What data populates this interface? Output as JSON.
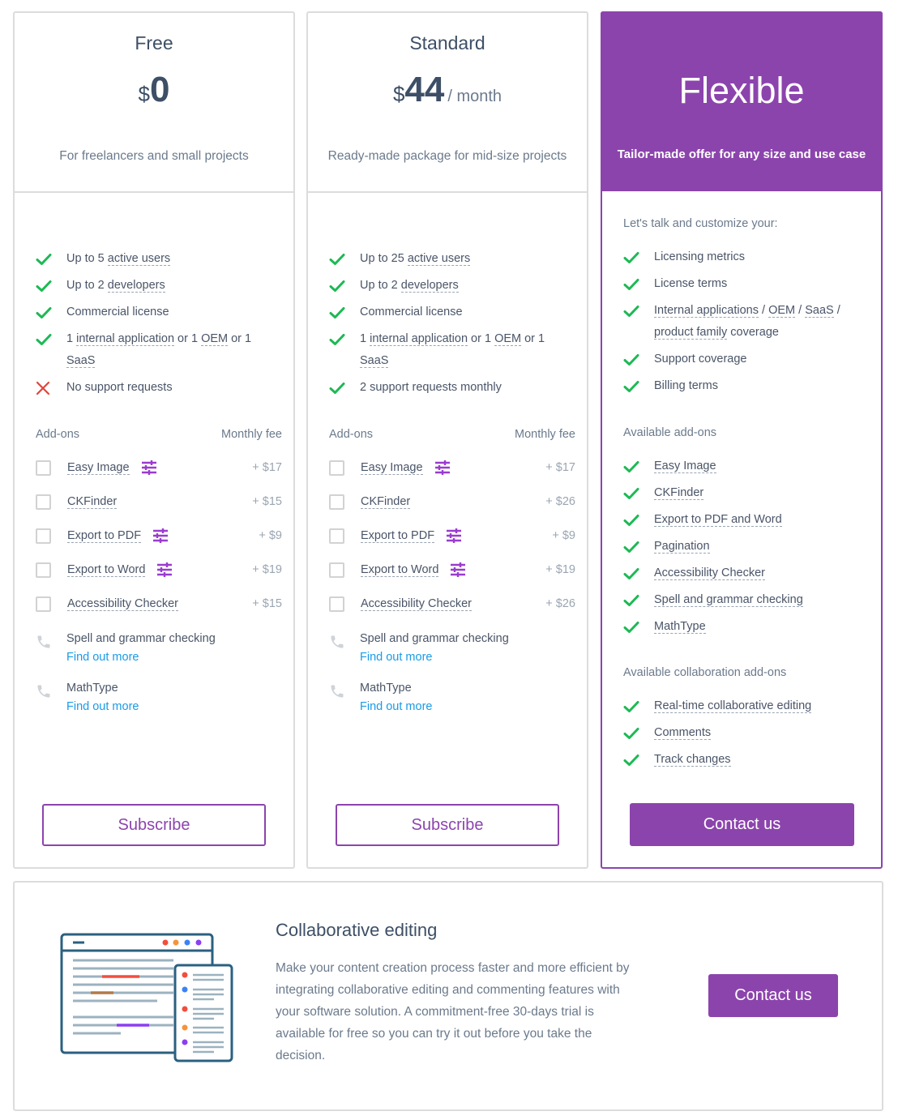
{
  "colors": {
    "accent": "#8c44ad",
    "check": "#1db954",
    "cross": "#e0453a",
    "link": "#1a9be6",
    "text": "#4a5568",
    "muted": "#6b7a8c"
  },
  "plans": {
    "free": {
      "name": "Free",
      "currency": "$",
      "amount": "0",
      "period": "",
      "description": "For freelancers and small projects",
      "features": [
        {
          "status": "check",
          "parts": [
            {
              "t": "Up to 5 "
            },
            {
              "t": "active users",
              "dotted": true
            }
          ]
        },
        {
          "status": "check",
          "parts": [
            {
              "t": "Up to 2 "
            },
            {
              "t": "developers",
              "dotted": true
            }
          ]
        },
        {
          "status": "check",
          "parts": [
            {
              "t": "Commercial license"
            }
          ]
        },
        {
          "status": "check",
          "parts": [
            {
              "t": "1 "
            },
            {
              "t": "internal application",
              "dotted": true
            },
            {
              "t": " or 1 "
            },
            {
              "t": "OEM",
              "dotted": true
            },
            {
              "t": " or 1 "
            },
            {
              "t": "SaaS",
              "dotted": true
            }
          ]
        },
        {
          "status": "cross",
          "parts": [
            {
              "t": "No support requests"
            }
          ]
        }
      ],
      "addons_label": "Add-ons",
      "fee_label": "Monthly fee",
      "addons": [
        {
          "name": "Easy Image",
          "configurable": true,
          "fee": "+ $17",
          "checked": false
        },
        {
          "name": "CKFinder",
          "configurable": false,
          "fee": "+ $15",
          "checked": false
        },
        {
          "name": "Export to PDF",
          "configurable": true,
          "fee": "+ $9",
          "checked": false
        },
        {
          "name": "Export to Word",
          "configurable": true,
          "fee": "+ $19",
          "checked": false
        },
        {
          "name": "Accessibility Checker",
          "configurable": false,
          "fee": "+ $15",
          "checked": false
        }
      ],
      "extras": [
        {
          "name": "Spell and grammar checking",
          "link": "Find out more"
        },
        {
          "name": "MathType",
          "link": "Find out more"
        }
      ],
      "button": "Subscribe"
    },
    "standard": {
      "name": "Standard",
      "currency": "$",
      "amount": "44",
      "period": "/ month",
      "description": "Ready-made package for mid-size projects",
      "features": [
        {
          "status": "check",
          "parts": [
            {
              "t": "Up to 25 "
            },
            {
              "t": "active users",
              "dotted": true
            }
          ]
        },
        {
          "status": "check",
          "parts": [
            {
              "t": "Up to 2 "
            },
            {
              "t": "developers",
              "dotted": true
            }
          ]
        },
        {
          "status": "check",
          "parts": [
            {
              "t": "Commercial license"
            }
          ]
        },
        {
          "status": "check",
          "parts": [
            {
              "t": "1 "
            },
            {
              "t": "internal application",
              "dotted": true
            },
            {
              "t": " or 1 "
            },
            {
              "t": "OEM",
              "dotted": true
            },
            {
              "t": " or 1 "
            },
            {
              "t": "SaaS",
              "dotted": true
            }
          ]
        },
        {
          "status": "check",
          "parts": [
            {
              "t": "2 support requests monthly"
            }
          ]
        }
      ],
      "addons_label": "Add-ons",
      "fee_label": "Monthly fee",
      "addons": [
        {
          "name": "Easy Image",
          "configurable": true,
          "fee": "+ $17",
          "checked": false
        },
        {
          "name": "CKFinder",
          "configurable": false,
          "fee": "+ $26",
          "checked": false
        },
        {
          "name": "Export to PDF",
          "configurable": true,
          "fee": "+ $9",
          "checked": false
        },
        {
          "name": "Export to Word",
          "configurable": true,
          "fee": "+ $19",
          "checked": false
        },
        {
          "name": "Accessibility Checker",
          "configurable": false,
          "fee": "+ $26",
          "checked": false
        }
      ],
      "extras": [
        {
          "name": "Spell and grammar checking",
          "link": "Find out more"
        },
        {
          "name": "MathType",
          "link": "Find out more"
        }
      ],
      "button": "Subscribe"
    },
    "flexible": {
      "name": "Flexible",
      "description": "Tailor-made offer for any size and use case",
      "intro": "Let's talk and customize your:",
      "features": [
        {
          "status": "check",
          "parts": [
            {
              "t": "Licensing metrics"
            }
          ]
        },
        {
          "status": "check",
          "parts": [
            {
              "t": "License terms"
            }
          ]
        },
        {
          "status": "check",
          "parts": [
            {
              "t": "Internal applications",
              "dotted": true
            },
            {
              "t": " / "
            },
            {
              "t": "OEM",
              "dotted": true
            },
            {
              "t": " / "
            },
            {
              "t": "SaaS",
              "dotted": true
            },
            {
              "t": " / "
            },
            {
              "t": "product family",
              "dotted": true
            },
            {
              "t": " coverage"
            }
          ]
        },
        {
          "status": "check",
          "parts": [
            {
              "t": "Support coverage"
            }
          ]
        },
        {
          "status": "check",
          "parts": [
            {
              "t": "Billing terms"
            }
          ]
        }
      ],
      "addons_label": "Available add-ons",
      "addons": [
        "Easy Image",
        "CKFinder",
        "Export to PDF and Word",
        "Pagination",
        "Accessibility Checker",
        "Spell and grammar checking",
        "MathType"
      ],
      "collab_label": "Available collaboration add-ons",
      "collab_addons": [
        "Real-time collaborative editing",
        "Comments",
        "Track changes"
      ],
      "button": "Contact us"
    }
  },
  "collab": {
    "title": "Collaborative editing",
    "text": "Make your content creation process faster and more efficient by integrating collaborative editing and commenting features with your software solution. A commitment-free 30-days trial is available for free so you can try it out before you take the decision.",
    "button": "Contact us",
    "illustration": "collaboration-illustration"
  }
}
